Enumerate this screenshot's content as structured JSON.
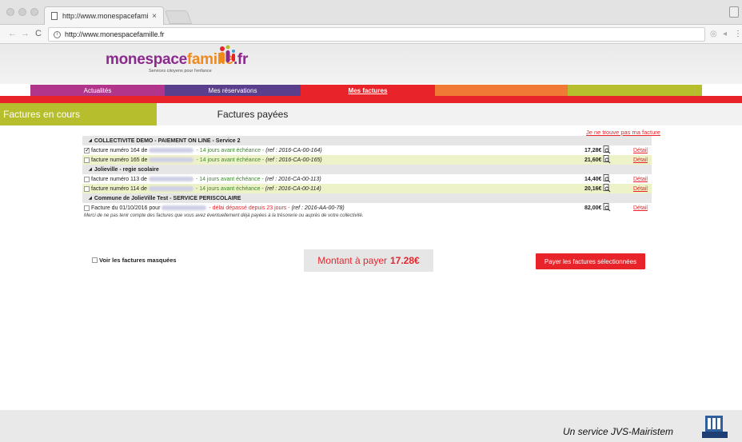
{
  "browser": {
    "tab_title": "http://www.monespacefamille",
    "tab_close": "×",
    "url": "http://www.monespacefamille.fr",
    "back": "←",
    "forward": "→",
    "reload": "C",
    "info": "i"
  },
  "header": {
    "logo_part1": "monespace",
    "logo_part2": "famille",
    "logo_part3": ".fr",
    "logo_sub": "Services citoyens pour l'enfance"
  },
  "menu": [
    {
      "label": "Actualités"
    },
    {
      "label": "Mes réservations"
    },
    {
      "label": "Mes factures"
    },
    {
      "label": ""
    },
    {
      "label": ""
    }
  ],
  "tabs": {
    "current": "Factures en cours",
    "paid": "Factures payées"
  },
  "not_found_link": "Je ne trouve pas ma facture",
  "groups": [
    {
      "title": "COLLECTIVITE DEMO - PAIEMENT ON LINE - Service 2",
      "invoices": [
        {
          "prefix": "facture numéro 164 de",
          "status": "- 14 jours avant échéance -",
          "ref": "(ref : 2016-CA-00-164)",
          "amount": "17,28€",
          "detail": "Détail",
          "checked": true
        },
        {
          "prefix": "facture numéro 165 de",
          "status": "- 14 jours avant échéance -",
          "ref": "(ref : 2016-CA-00-165)",
          "amount": "21,60€",
          "detail": "Détail",
          "checked": false
        }
      ]
    },
    {
      "title": "Jolieville - regie scolaire",
      "invoices": [
        {
          "prefix": "facture numéro 113 de",
          "status": "- 14 jours avant échéance -",
          "ref": "(ref : 2016-CA-00-113)",
          "amount": "14,40€",
          "detail": "Détail",
          "checked": false
        },
        {
          "prefix": "facture numéro 114 de",
          "status": "- 14 jours avant échéance -",
          "ref": "(ref : 2016-CA-00-114)",
          "amount": "20,16€",
          "detail": "Détail",
          "checked": false
        }
      ]
    },
    {
      "title": "Commune de JolieVille Test - SERVICE PERISCOLAIRE",
      "invoices": [
        {
          "prefix": "Facture du 01/10/2016 pour",
          "status": "- délai dépassé depuis 23 jours -",
          "ref": "(ref : 2016-AA-00-78)",
          "amount": "82,00€",
          "detail": "Détail",
          "checked": false
        }
      ]
    }
  ],
  "note": "Merci de ne pas tenir compte des factures que vous avez éventuellement déjà payées à la trésorerie ou auprès de votre collectivité.",
  "show_masked": "Voir les factures masquées",
  "total": {
    "label": "Montant à payer",
    "value": "17.28€"
  },
  "pay_button": "Payer les factures sélectionnées",
  "footer": {
    "text": "Un service JVS-Mairistem"
  },
  "colors": {
    "accent_red": "#e8232a",
    "tab_green": "#b6be2e",
    "menu_purple": "#b2358c",
    "menu_violet": "#5a3f8c",
    "menu_orange": "#f07a35"
  }
}
